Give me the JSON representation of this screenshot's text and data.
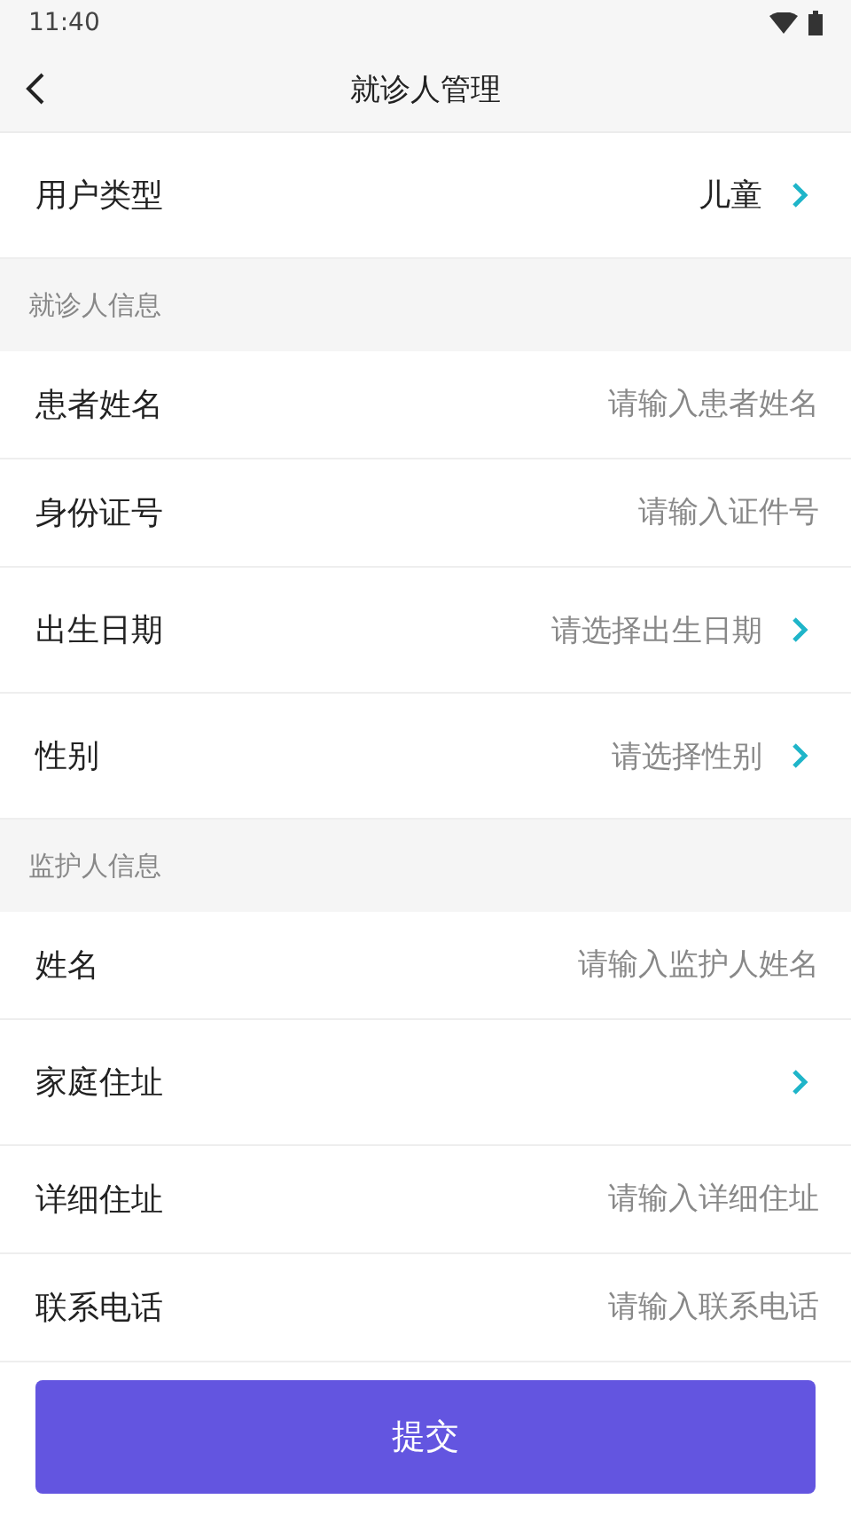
{
  "status_bar": {
    "time": "11:40"
  },
  "header": {
    "title": "就诊人管理"
  },
  "user_type": {
    "label": "用户类型",
    "value": "儿童"
  },
  "sections": [
    {
      "title": "就诊人信息",
      "rows": [
        {
          "label": "患者姓名",
          "kind": "input",
          "placeholder": "请输入患者姓名"
        },
        {
          "label": "身份证号",
          "kind": "input",
          "placeholder": "请输入证件号"
        },
        {
          "label": "出生日期",
          "kind": "select",
          "placeholder": "请选择出生日期"
        },
        {
          "label": "性别",
          "kind": "select",
          "placeholder": "请选择性别"
        }
      ]
    },
    {
      "title": "监护人信息",
      "rows": [
        {
          "label": "姓名",
          "kind": "input",
          "placeholder": "请输入监护人姓名"
        },
        {
          "label": "家庭住址",
          "kind": "select"
        },
        {
          "label": "详细住址",
          "kind": "input",
          "placeholder": "请输入详细住址"
        },
        {
          "label": "联系电话",
          "kind": "input",
          "placeholder": "请输入联系电话"
        }
      ]
    }
  ],
  "submit_button": "提交"
}
